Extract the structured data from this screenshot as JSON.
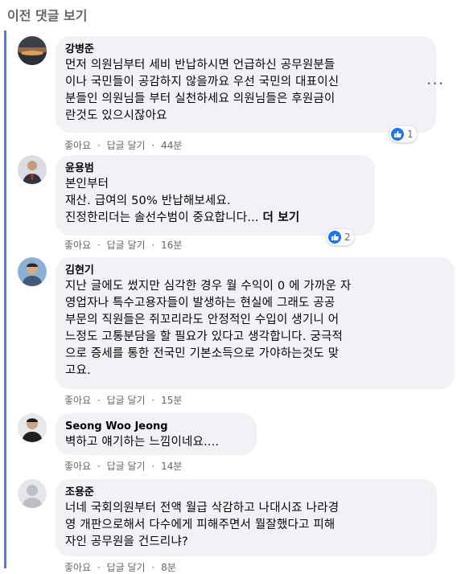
{
  "header": {
    "view_previous": "이전 댓글 보기"
  },
  "actions": {
    "like": "좋아요",
    "reply": "답글 달기",
    "separator": "·",
    "more_options": "···"
  },
  "comments": [
    {
      "author": "강병준",
      "lines": [
        "먼저 의원님부터 세비 반납하시면 언급하신 공무원분들",
        "이나 국민들이 공감하지 않을까요 우선 국민의 대표이신",
        "분들인 의원님들 부터 실천하세요 의원님들은 후원금이",
        "란것도 있으시잖아요"
      ],
      "time": "44분",
      "reactions": "1"
    },
    {
      "author": "윤용범",
      "lines": [
        "본인부터",
        "재산. 급여의 50% 반납해보세요.",
        "진정한리더는 솔선수범이 중요합니다..."
      ],
      "see_more": "더 보기",
      "time": "16분",
      "reactions": "2"
    },
    {
      "author": "김현기",
      "lines": [
        "지난 글에도 썼지만 심각한 경우 월 수익이 0 에 가까운 자",
        "영업자나 특수고용자들이 발생하는 현실에 그래도 공공",
        "부문의 직원들은 쥐꼬리라도 안정적인 수입이 생기니 어",
        "느정도 고통분담을 할 필요가 있다고 생각합니다. 궁극적",
        "으로 증세를 통한 전국민 기본소득으로 가야하는것도 맞",
        "고요."
      ],
      "time": "15분"
    },
    {
      "author": "Seong Woo Jeong",
      "lines": [
        "벽하고 얘기하는 느낌이네요...."
      ],
      "time": "14분"
    },
    {
      "author": "조용준",
      "lines": [
        "너네 국회의원부터 전액 월급 삭감하고 나대시죠 나라경",
        "영 개판으로해서 다수에게 피해주면서 뭘잘했다고 피해",
        "자인 공무원을 건드리냐?"
      ],
      "time": "8분"
    }
  ]
}
